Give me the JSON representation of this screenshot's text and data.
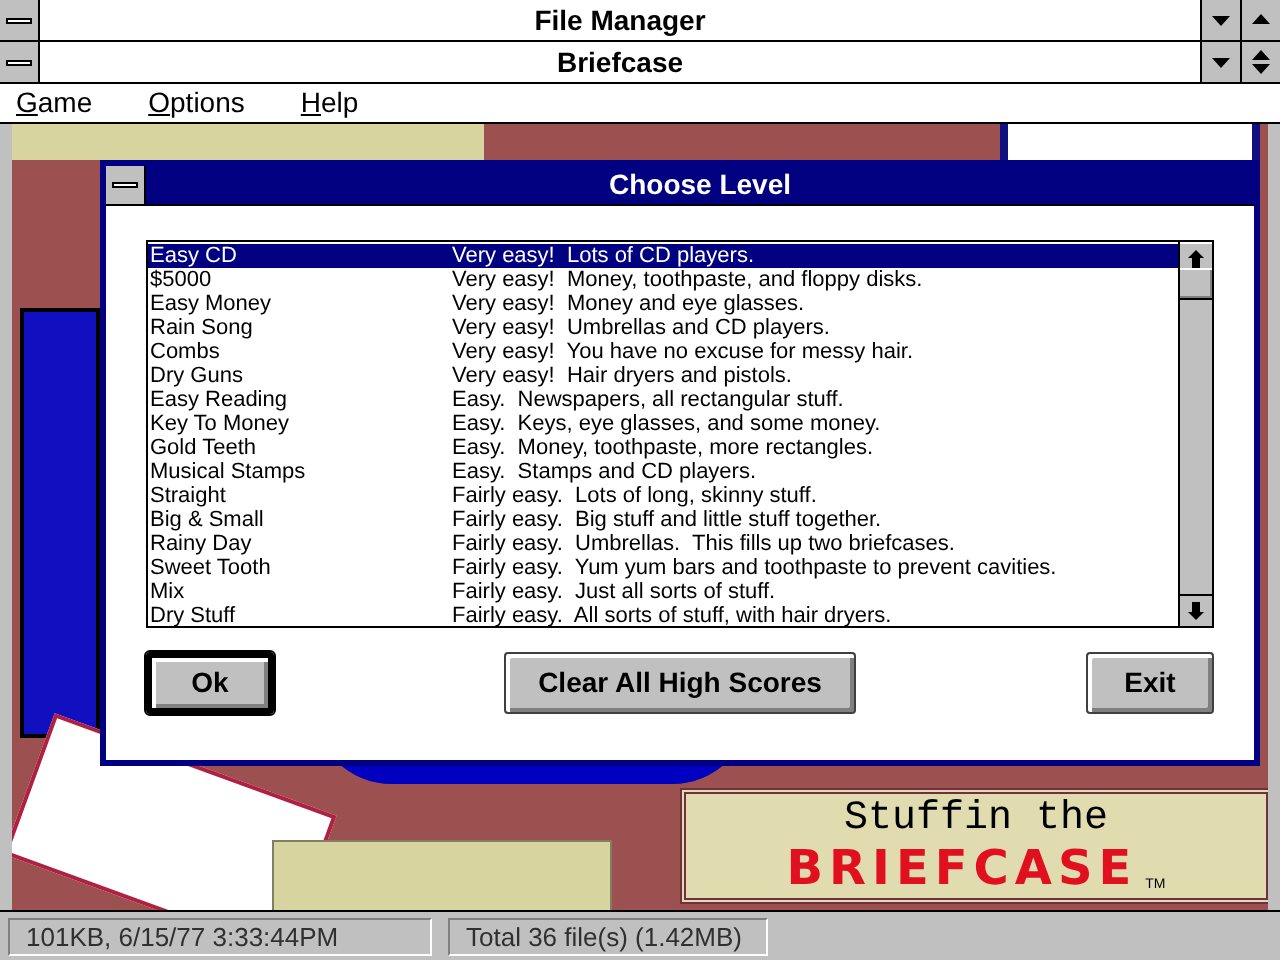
{
  "outer_window": {
    "title": "File Manager"
  },
  "window": {
    "title": "Briefcase",
    "menu": [
      {
        "mnemonic": "G",
        "rest": "ame"
      },
      {
        "mnemonic": "O",
        "rest": "ptions"
      },
      {
        "mnemonic": "H",
        "rest": "elp"
      }
    ]
  },
  "dialog": {
    "title": "Choose Level",
    "levels": [
      {
        "name": "Easy CD",
        "description": "Very easy!  Lots of CD players.",
        "selected": true
      },
      {
        "name": "$5000",
        "description": "Very easy!  Money, toothpaste, and floppy disks.",
        "selected": false
      },
      {
        "name": "Easy Money",
        "description": "Very easy!  Money and eye glasses.",
        "selected": false
      },
      {
        "name": "Rain Song",
        "description": "Very easy!  Umbrellas and CD players.",
        "selected": false
      },
      {
        "name": "Combs",
        "description": "Very easy!  You have no excuse for messy hair.",
        "selected": false
      },
      {
        "name": "Dry Guns",
        "description": "Very easy!  Hair dryers and pistols.",
        "selected": false
      },
      {
        "name": "Easy Reading",
        "description": "Easy.  Newspapers, all rectangular stuff.",
        "selected": false
      },
      {
        "name": "Key To Money",
        "description": "Easy.  Keys, eye glasses, and some money.",
        "selected": false
      },
      {
        "name": "Gold Teeth",
        "description": "Easy.  Money, toothpaste, more rectangles.",
        "selected": false
      },
      {
        "name": "Musical Stamps",
        "description": "Easy.  Stamps and CD players.",
        "selected": false
      },
      {
        "name": "Straight",
        "description": "Fairly easy.  Lots of long, skinny stuff.",
        "selected": false
      },
      {
        "name": "Big & Small",
        "description": "Fairly easy.  Big stuff and little stuff together.",
        "selected": false
      },
      {
        "name": "Rainy Day",
        "description": "Fairly easy.  Umbrellas.  This fills up two briefcases.",
        "selected": false
      },
      {
        "name": "Sweet Tooth",
        "description": "Fairly easy.  Yum yum bars and toothpaste to prevent cavities.",
        "selected": false
      },
      {
        "name": "Mix",
        "description": "Fairly easy.  Just all sorts of stuff.",
        "selected": false
      },
      {
        "name": "Dry Stuff",
        "description": "Fairly easy.  All sorts of stuff, with hair dryers.",
        "selected": false
      }
    ],
    "buttons": [
      {
        "label": "Ok",
        "focused": true
      },
      {
        "label": "Clear All High Scores",
        "focused": false
      },
      {
        "label": "Exit",
        "focused": false
      }
    ]
  },
  "logo": {
    "line_1": "Stuffin the",
    "line_2": "BRIEFCASE",
    "trademark": "TM"
  },
  "status_bar": [
    "101KB, 6/15/77 3:33:44PM",
    "Total 36 file(s) (1.42MB)"
  ]
}
